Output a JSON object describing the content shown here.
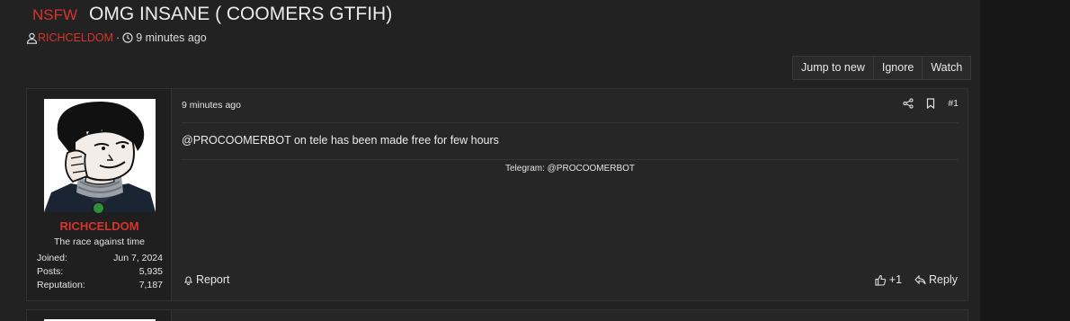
{
  "thread": {
    "prefix": "NSFW",
    "title": "OMG INSANE ( COOMERS GTFIH)",
    "author": "RICHCELDOM",
    "separator": "·",
    "time": "9 minutes ago"
  },
  "toolbar": {
    "jump_to_new": "Jump to new",
    "ignore": "Ignore",
    "watch": "Watch"
  },
  "post": {
    "date": "9 minutes ago",
    "number": "#1",
    "message": "@PROCOOMERBOT on tele has been made free for few hours",
    "signature": "Telegram: @PROCOOMERBOT",
    "report_label": "Report",
    "like_label": "+1",
    "reply_label": "Reply"
  },
  "user": {
    "name": "RICHCELDOM",
    "title": "The race against time",
    "stats": [
      {
        "label": "Joined:",
        "value": "Jun 7, 2024"
      },
      {
        "label": "Posts:",
        "value": "5,935"
      },
      {
        "label": "Reputation:",
        "value": "7,187"
      }
    ]
  },
  "colors": {
    "accent_red": "#d9342b",
    "page_bg": "#222222",
    "online_green": "#2f8f3a"
  },
  "icons": {
    "author": "user-icon",
    "time": "clock-icon",
    "share": "share-icon",
    "bookmark": "bookmark-icon",
    "report": "bell-icon",
    "like": "thumbs-up-icon",
    "reply": "reply-icon"
  }
}
